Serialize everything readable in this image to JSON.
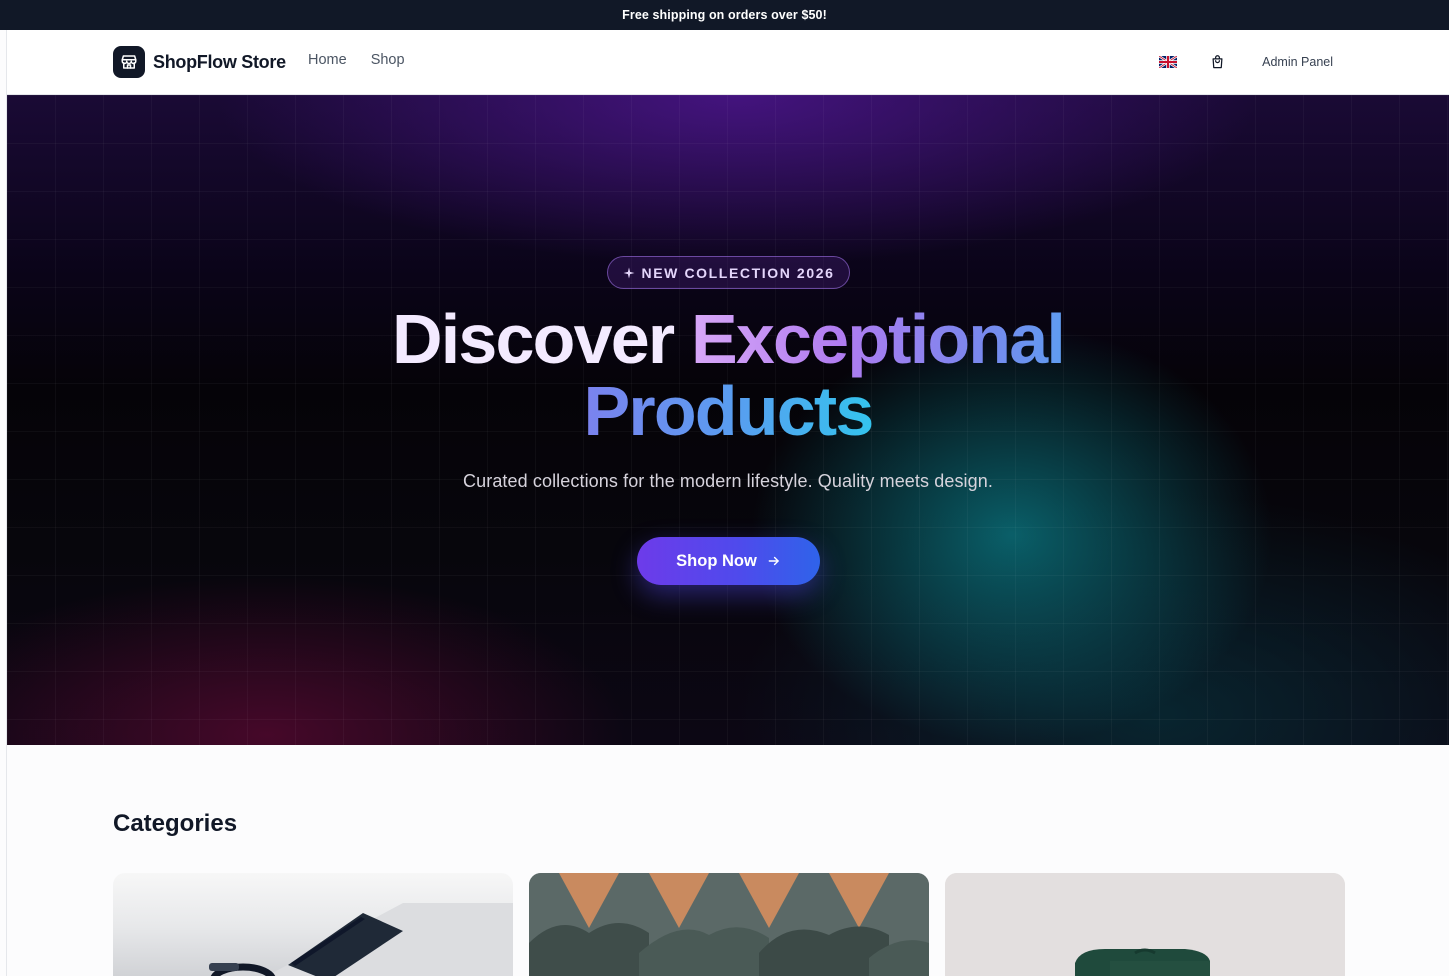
{
  "announcement": {
    "text": "Free shipping on orders over $50!"
  },
  "header": {
    "brand_name": "ShopFlow Store",
    "nav": [
      {
        "label": "Home"
      },
      {
        "label": "Shop"
      }
    ],
    "language_icon": "uk-flag-icon",
    "cart_icon": "shopping-bag-icon",
    "admin_label": "Admin Panel"
  },
  "hero": {
    "badge_icon": "sparkle-icon",
    "badge_text": "NEW COLLECTION 2026",
    "title_part1": "Discover",
    "title_part2": "Exceptional",
    "title_part3": "Products",
    "subtitle": "Curated collections for the modern lifestyle. Quality meets design.",
    "cta_label": "Shop Now",
    "cta_icon": "arrow-right-icon"
  },
  "categories": {
    "title": "Categories",
    "cards": [
      {
        "name": "accessories-image"
      },
      {
        "name": "clothing-image"
      },
      {
        "name": "furniture-image"
      }
    ]
  },
  "colors": {
    "announcement_bg": "#111827",
    "cta_start": "#6d3bea",
    "cta_end": "#2f63ea",
    "hero_bg": "#07060c"
  }
}
